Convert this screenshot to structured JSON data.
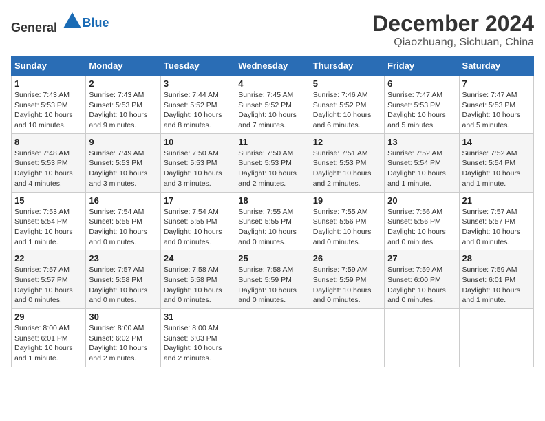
{
  "logo": {
    "general": "General",
    "blue": "Blue"
  },
  "title": "December 2024",
  "subtitle": "Qiaozhuang, Sichuan, China",
  "weekdays": [
    "Sunday",
    "Monday",
    "Tuesday",
    "Wednesday",
    "Thursday",
    "Friday",
    "Saturday"
  ],
  "weeks": [
    [
      {
        "day": "1",
        "info": "Sunrise: 7:43 AM\nSunset: 5:53 PM\nDaylight: 10 hours\nand 10 minutes."
      },
      {
        "day": "2",
        "info": "Sunrise: 7:43 AM\nSunset: 5:53 PM\nDaylight: 10 hours\nand 9 minutes."
      },
      {
        "day": "3",
        "info": "Sunrise: 7:44 AM\nSunset: 5:52 PM\nDaylight: 10 hours\nand 8 minutes."
      },
      {
        "day": "4",
        "info": "Sunrise: 7:45 AM\nSunset: 5:52 PM\nDaylight: 10 hours\nand 7 minutes."
      },
      {
        "day": "5",
        "info": "Sunrise: 7:46 AM\nSunset: 5:52 PM\nDaylight: 10 hours\nand 6 minutes."
      },
      {
        "day": "6",
        "info": "Sunrise: 7:47 AM\nSunset: 5:53 PM\nDaylight: 10 hours\nand 5 minutes."
      },
      {
        "day": "7",
        "info": "Sunrise: 7:47 AM\nSunset: 5:53 PM\nDaylight: 10 hours\nand 5 minutes."
      }
    ],
    [
      {
        "day": "8",
        "info": "Sunrise: 7:48 AM\nSunset: 5:53 PM\nDaylight: 10 hours\nand 4 minutes."
      },
      {
        "day": "9",
        "info": "Sunrise: 7:49 AM\nSunset: 5:53 PM\nDaylight: 10 hours\nand 3 minutes."
      },
      {
        "day": "10",
        "info": "Sunrise: 7:50 AM\nSunset: 5:53 PM\nDaylight: 10 hours\nand 3 minutes."
      },
      {
        "day": "11",
        "info": "Sunrise: 7:50 AM\nSunset: 5:53 PM\nDaylight: 10 hours\nand 2 minutes."
      },
      {
        "day": "12",
        "info": "Sunrise: 7:51 AM\nSunset: 5:53 PM\nDaylight: 10 hours\nand 2 minutes."
      },
      {
        "day": "13",
        "info": "Sunrise: 7:52 AM\nSunset: 5:54 PM\nDaylight: 10 hours\nand 1 minute."
      },
      {
        "day": "14",
        "info": "Sunrise: 7:52 AM\nSunset: 5:54 PM\nDaylight: 10 hours\nand 1 minute."
      }
    ],
    [
      {
        "day": "15",
        "info": "Sunrise: 7:53 AM\nSunset: 5:54 PM\nDaylight: 10 hours\nand 1 minute."
      },
      {
        "day": "16",
        "info": "Sunrise: 7:54 AM\nSunset: 5:55 PM\nDaylight: 10 hours\nand 0 minutes."
      },
      {
        "day": "17",
        "info": "Sunrise: 7:54 AM\nSunset: 5:55 PM\nDaylight: 10 hours\nand 0 minutes."
      },
      {
        "day": "18",
        "info": "Sunrise: 7:55 AM\nSunset: 5:55 PM\nDaylight: 10 hours\nand 0 minutes."
      },
      {
        "day": "19",
        "info": "Sunrise: 7:55 AM\nSunset: 5:56 PM\nDaylight: 10 hours\nand 0 minutes."
      },
      {
        "day": "20",
        "info": "Sunrise: 7:56 AM\nSunset: 5:56 PM\nDaylight: 10 hours\nand 0 minutes."
      },
      {
        "day": "21",
        "info": "Sunrise: 7:57 AM\nSunset: 5:57 PM\nDaylight: 10 hours\nand 0 minutes."
      }
    ],
    [
      {
        "day": "22",
        "info": "Sunrise: 7:57 AM\nSunset: 5:57 PM\nDaylight: 10 hours\nand 0 minutes."
      },
      {
        "day": "23",
        "info": "Sunrise: 7:57 AM\nSunset: 5:58 PM\nDaylight: 10 hours\nand 0 minutes."
      },
      {
        "day": "24",
        "info": "Sunrise: 7:58 AM\nSunset: 5:58 PM\nDaylight: 10 hours\nand 0 minutes."
      },
      {
        "day": "25",
        "info": "Sunrise: 7:58 AM\nSunset: 5:59 PM\nDaylight: 10 hours\nand 0 minutes."
      },
      {
        "day": "26",
        "info": "Sunrise: 7:59 AM\nSunset: 5:59 PM\nDaylight: 10 hours\nand 0 minutes."
      },
      {
        "day": "27",
        "info": "Sunrise: 7:59 AM\nSunset: 6:00 PM\nDaylight: 10 hours\nand 0 minutes."
      },
      {
        "day": "28",
        "info": "Sunrise: 7:59 AM\nSunset: 6:01 PM\nDaylight: 10 hours\nand 1 minute."
      }
    ],
    [
      {
        "day": "29",
        "info": "Sunrise: 8:00 AM\nSunset: 6:01 PM\nDaylight: 10 hours\nand 1 minute."
      },
      {
        "day": "30",
        "info": "Sunrise: 8:00 AM\nSunset: 6:02 PM\nDaylight: 10 hours\nand 2 minutes."
      },
      {
        "day": "31",
        "info": "Sunrise: 8:00 AM\nSunset: 6:03 PM\nDaylight: 10 hours\nand 2 minutes."
      },
      null,
      null,
      null,
      null
    ]
  ]
}
